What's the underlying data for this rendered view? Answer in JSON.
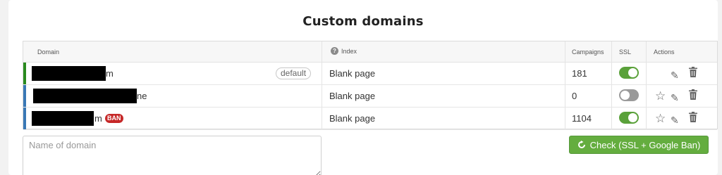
{
  "page": {
    "title": "Custom domains"
  },
  "table": {
    "headers": {
      "domain": "Domain",
      "index": "Index",
      "campaigns": "Campaigns",
      "ssl": "SSL",
      "actions": "Actions"
    },
    "rows": [
      {
        "domain_visible": "m",
        "badge": "default",
        "index": "Blank page",
        "campaigns": "181",
        "ssl": "on",
        "stripe_color": "#2a8a1f"
      },
      {
        "domain_visible": "ne",
        "badge": "",
        "index": "Blank page",
        "campaigns": "0",
        "ssl": "off",
        "stripe_color": "#3a78b5"
      },
      {
        "domain_visible": "m",
        "badge": "BAN",
        "index": "Blank page",
        "campaigns": "1104",
        "ssl": "on",
        "stripe_color": "#3a78b5"
      }
    ]
  },
  "form": {
    "domain_placeholder": "Name of domain",
    "check_button_label": "Check (SSL + Google Ban)"
  },
  "icons": {
    "help": "question-circle-icon",
    "star": "star-icon",
    "edit": "pencil-icon",
    "delete": "trash-icon",
    "refresh": "refresh-icon"
  },
  "colors": {
    "primary_green": "#64ad3f",
    "ban_red": "#c62828",
    "toggle_on": "#5aa13a",
    "toggle_off": "#9a9a9a"
  }
}
